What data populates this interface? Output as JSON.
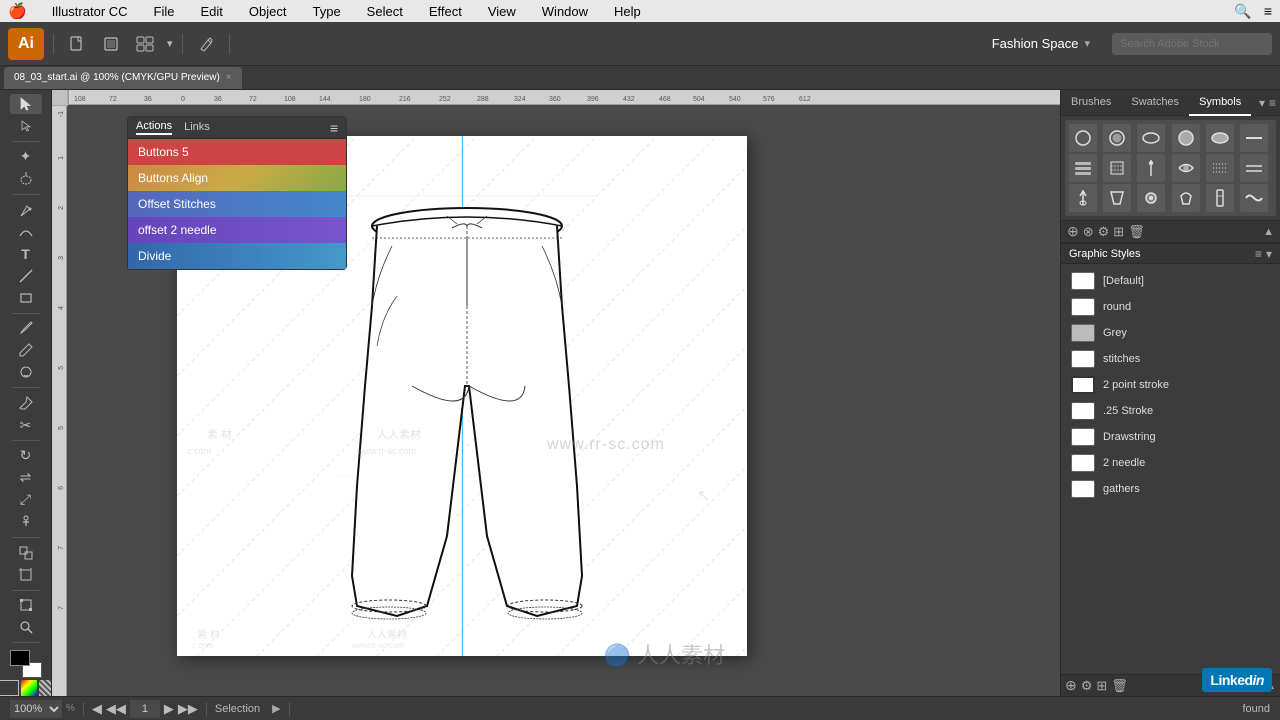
{
  "menubar": {
    "apple": "🍎",
    "app_name": "Illustrator CC",
    "menus": [
      "File",
      "Edit",
      "Object",
      "Type",
      "Select",
      "Effect",
      "View",
      "Window",
      "Help"
    ]
  },
  "toolbar": {
    "workspace_label": "Fashion Space",
    "search_placeholder": "Search Adobe Stock",
    "ai_logo": "Ai"
  },
  "tab": {
    "filename": "08_03_start.ai @ 100% (CMYK/GPU Preview)",
    "close_icon": "×"
  },
  "actions_panel": {
    "title": "Actions",
    "tab1": "Actions",
    "tab2": "Links",
    "items": [
      {
        "label": "Buttons 5",
        "class": "action-item-buttons5"
      },
      {
        "label": "Buttons Align",
        "class": "action-item-buttons-align"
      },
      {
        "label": "Offset Stitches",
        "class": "action-item-offset"
      },
      {
        "label": "offset 2 needle",
        "class": "action-item-offset-needle"
      },
      {
        "label": "Divide",
        "class": "action-item-divide"
      }
    ]
  },
  "right_panels": {
    "tabs": [
      "Brushes",
      "Swatches",
      "Symbols"
    ],
    "active_tab": "Symbols",
    "graphic_styles_title": "Graphic",
    "graphic_styles_panel": "Graphic Styles",
    "styles": [
      {
        "name": "[Default]",
        "bg": "#ffffff"
      },
      {
        "name": "round",
        "bg": "#ffffff"
      },
      {
        "name": "Grey",
        "bg": "#cccccc"
      },
      {
        "name": "stitches",
        "bg": "#ffffff"
      },
      {
        "name": "2 point stroke",
        "bg": "#ffffff"
      },
      {
        "name": ".25 Stroke",
        "bg": "#ffffff"
      },
      {
        "name": "Drawstring",
        "bg": "#ffffff"
      },
      {
        "name": "2 needle",
        "bg": "#ffffff"
      },
      {
        "name": "gathers",
        "bg": "#ffffff"
      }
    ]
  },
  "statusbar": {
    "zoom": "100%",
    "artboard_num": "1",
    "selection_info": "Selection",
    "found_text": "found"
  },
  "canvas": {
    "watermark": "www.rr-sc.com",
    "watermark_cn": "人人素材"
  }
}
